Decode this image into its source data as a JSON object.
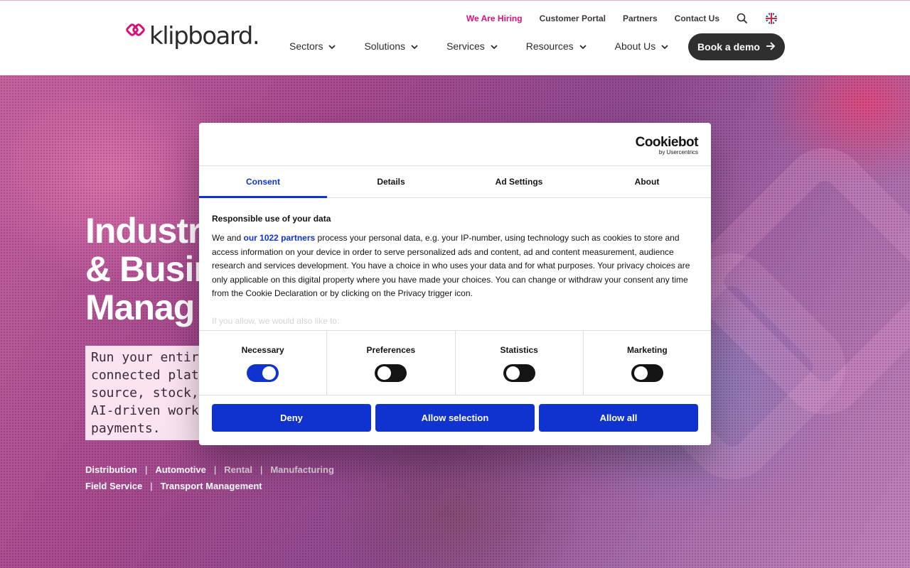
{
  "brand": {
    "name": "klipboard",
    "accent": "#d6127a",
    "dark": "#2f2f2f"
  },
  "topnav": {
    "hiring": "We Are Hiring",
    "portal": "Customer Portal",
    "partners": "Partners",
    "contact": "Contact Us",
    "search_icon": "search-icon",
    "language_icon": "uk-flag-icon"
  },
  "mainnav": {
    "items": [
      {
        "label": "Sectors"
      },
      {
        "label": "Solutions"
      },
      {
        "label": "Services"
      },
      {
        "label": "Resources"
      },
      {
        "label": "About Us"
      }
    ],
    "cta": "Book a demo"
  },
  "hero": {
    "title_lines": [
      "Industr",
      "& Busin",
      "Manag"
    ],
    "body_lines": [
      "Run your entir",
      "connected plat",
      "source, stock,",
      "AI-driven work",
      "payments."
    ],
    "links_row1": [
      "Distribution",
      "Automotive",
      "Rental",
      "Manufacturing"
    ],
    "links_row2": [
      "Field Service",
      "Transport Management"
    ]
  },
  "cookie": {
    "logo_word": "Cookiebot",
    "logo_by": "by Usercentrics",
    "accent": "#1032cf",
    "tabs": [
      {
        "label": "Consent",
        "active": true
      },
      {
        "label": "Details",
        "active": false
      },
      {
        "label": "Ad Settings",
        "active": false
      },
      {
        "label": "About",
        "active": false
      }
    ],
    "heading": "Responsible use of your data",
    "text_before_link": "We and ",
    "link_text": "our 1022 partners",
    "text_after_link": " process your personal data, e.g. your IP-number, using technology such as cookies to store and access information on your device in order to serve personalized ads and content, ad and content measurement, audience research and services development. You have a choice in who uses your data and for what purposes. Your privacy choices are only applicable on this digital property where you have made your choices. You can change or withdraw your consent any time from the Cookie Declaration or by clicking on the Privacy trigger icon.",
    "faded_text": "If you allow, we would also like to:",
    "toggles": [
      {
        "label": "Necessary",
        "on": true
      },
      {
        "label": "Preferences",
        "on": false
      },
      {
        "label": "Statistics",
        "on": false
      },
      {
        "label": "Marketing",
        "on": false
      }
    ],
    "buttons": {
      "deny": "Deny",
      "allow_selection": "Allow selection",
      "allow_all": "Allow all"
    }
  }
}
